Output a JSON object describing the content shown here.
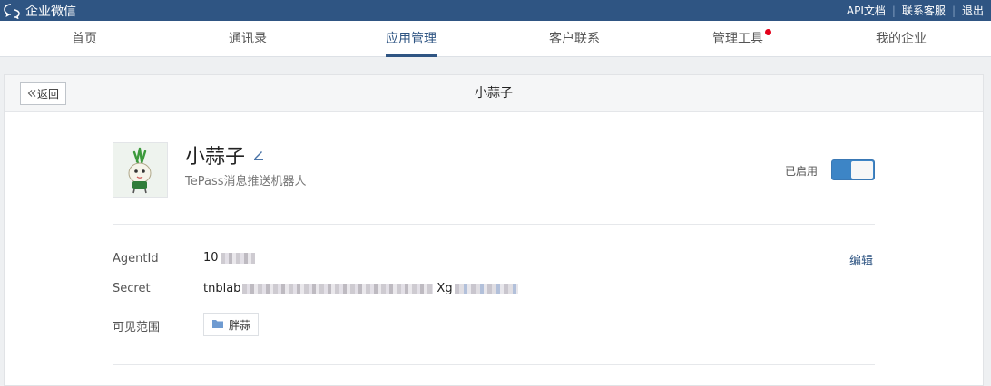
{
  "topbar": {
    "brand": "企业微信",
    "links": [
      "API文档",
      "联系客服",
      "退出"
    ]
  },
  "nav": {
    "items": [
      "首页",
      "通讯录",
      "应用管理",
      "客户联系",
      "管理工具",
      "我的企业"
    ],
    "active": "应用管理",
    "badge_item": "管理工具"
  },
  "panel": {
    "back_label": "返回",
    "title": "小蒜子"
  },
  "app": {
    "name": "小蒜子",
    "description": "TePass消息推送机器人",
    "enabled_label": "已启用",
    "enabled": true
  },
  "details": {
    "agentid_label": "AgentId",
    "agentid_value": "10",
    "secret_label": "Secret",
    "secret_prefix": "tnblab",
    "secret_mid": "Xg",
    "scope_label": "可见范围",
    "scope_value": "胖蒜",
    "edit_label": "编辑"
  },
  "colors": {
    "brand_blue": "#2f5583",
    "toggle_blue": "#3d85c6",
    "badge_red": "#e4001b"
  },
  "icons": {
    "brand": "chat-bubbles-icon",
    "back": "double-chevron-left-icon",
    "edit": "pencil-icon",
    "folder": "folder-icon"
  }
}
